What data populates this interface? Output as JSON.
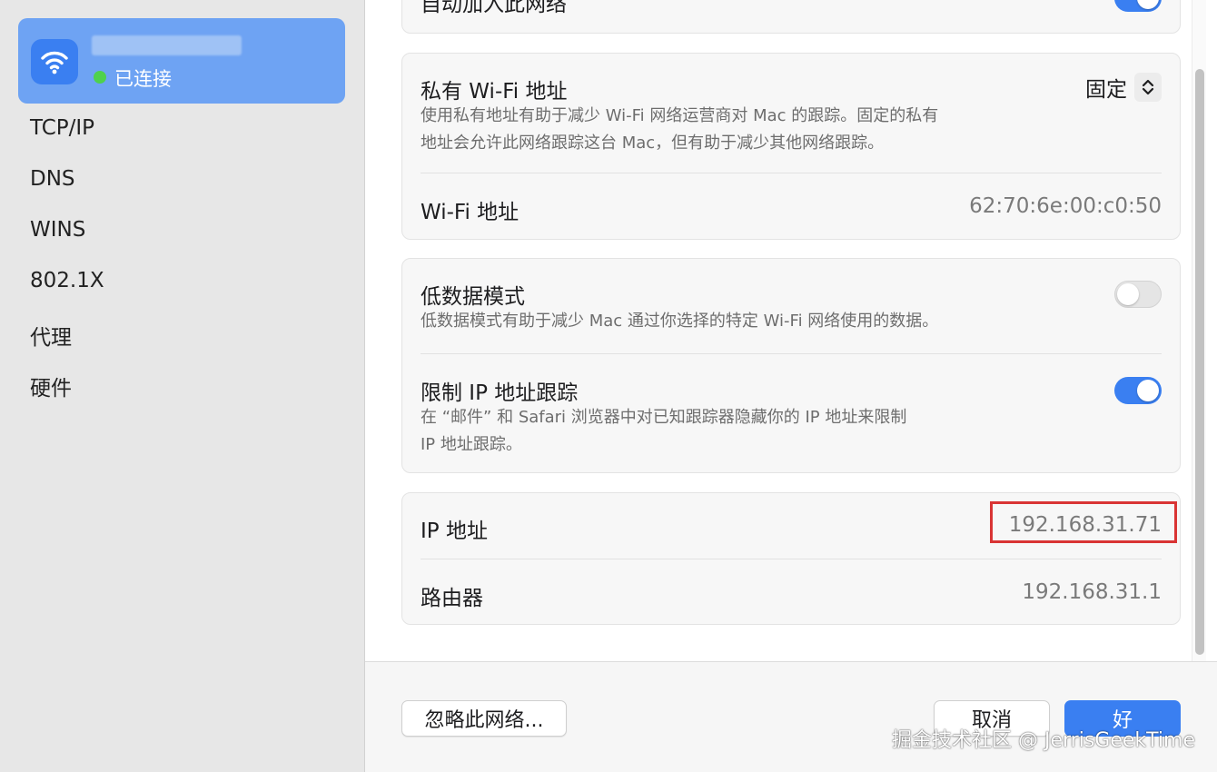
{
  "sidebar": {
    "network": {
      "status": "已连接"
    },
    "items": [
      {
        "label": "TCP/IP"
      },
      {
        "label": "DNS"
      },
      {
        "label": "WINS"
      },
      {
        "label": "802.1X"
      },
      {
        "label": "代理"
      },
      {
        "label": "硬件"
      }
    ]
  },
  "main": {
    "auto_join": {
      "title": "自动加入此网络",
      "enabled": true
    },
    "private_address": {
      "title": "私有 Wi-Fi 地址",
      "description_line1": "使用私有地址有助于减少 Wi-Fi 网络运营商对 Mac 的跟踪。固定的私有",
      "description_line2": "地址会允许此网络跟踪这台 Mac，但有助于减少其他网络跟踪。",
      "mode": "固定"
    },
    "wifi_address": {
      "label": "Wi-Fi 地址",
      "value": "62:70:6e:00:c0:50"
    },
    "low_data": {
      "title": "低数据模式",
      "description": "低数据模式有助于减少 Mac 通过你选择的特定 Wi-Fi 网络使用的数据。",
      "enabled": false
    },
    "limit_ip_tracking": {
      "title": "限制 IP 地址跟踪",
      "description_line1": "在 “邮件” 和 Safari 浏览器中对已知跟踪器隐藏你的 IP 地址来限制",
      "description_line2": "IP 地址跟踪。",
      "enabled": true
    },
    "ip_address": {
      "label": "IP 地址",
      "value": "192.168.31.71"
    },
    "router": {
      "label": "路由器",
      "value": "192.168.31.1"
    }
  },
  "footer": {
    "forget_label": "忽略此网络...",
    "cancel_label": "取消",
    "ok_label": "好"
  },
  "watermark": "掘金技术社区 @ JerrisGeekTime",
  "colors": {
    "accent": "#3a7ff1",
    "selected_card": "#6ea3f3",
    "highlight": "#d93434",
    "connected_dot": "#4fd14d"
  }
}
